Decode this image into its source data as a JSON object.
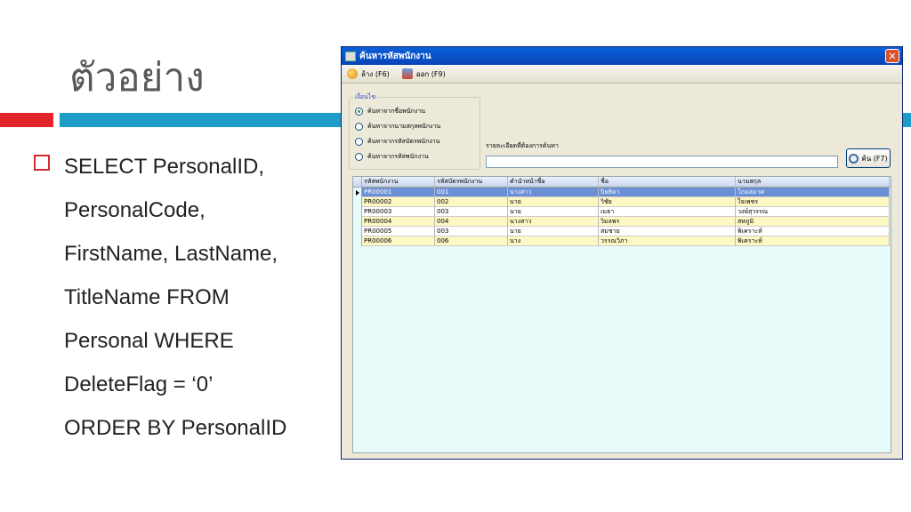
{
  "slide": {
    "title": "ตัวอย่าง",
    "sql_lines": [
      "SELECT PersonalID,",
      "PersonalCode,",
      "FirstName, LastName,",
      "TitleName  FROM",
      "Personal WHERE",
      "DeleteFlag = ‘0’",
      "ORDER BY PersonalID"
    ]
  },
  "window": {
    "title": "ค้นหารหัสพนักงาน",
    "close_glyph": "✕"
  },
  "toolbar": {
    "clear_label": "ล้าง (F6)",
    "exit_label": "ออก (F9)"
  },
  "condition": {
    "legend": "เงื่อนไข",
    "options": [
      "ค้นหาจากชื่อพนักงาน",
      "ค้นหาจากนามสกุลพนักงาน",
      "ค้นหาจากรหัสบัตรพนักงาน",
      "ค้นหาจากรหัสพนักงาน"
    ],
    "selected_index": 0
  },
  "search": {
    "label": "รายละเอียดที่ต้องการค้นหา",
    "value": "",
    "button_label": "ค้น (F7)"
  },
  "grid": {
    "columns": [
      "รหัสพนักงาน",
      "รหัสบัตรพนักงาน",
      "คำนำหน้าชื่อ",
      "ชื่อ",
      "นามสกุล"
    ],
    "rows": [
      [
        "PR00001",
        "001",
        "นางสาว",
        "ปิยธิดา",
        "โกมลมาศ"
      ],
      [
        "PR00002",
        "002",
        "นาย",
        "วิชัย",
        "ใจเพชร"
      ],
      [
        "PR00003",
        "003",
        "นาย",
        "เมธา",
        "วงษ์สุวรรณ"
      ],
      [
        "PR00004",
        "004",
        "นางสาว",
        "วิมลพร",
        "สหภูมิ"
      ],
      [
        "PR00005",
        "003",
        "นาย",
        "สมชาย",
        "พิเคราะห์"
      ],
      [
        "PR00006",
        "006",
        "นาง",
        "วรรณวิภา",
        "พิเคราะห์"
      ]
    ],
    "selected_row": 0
  },
  "colors": {
    "accent_red": "#e3252b",
    "accent_teal": "#1f9bc8",
    "title_bar": "#0a5fd8",
    "row_alt": "#fdf7c4",
    "row_selected": "#6b8fd4",
    "grid_bg": "#e8fbfb"
  }
}
